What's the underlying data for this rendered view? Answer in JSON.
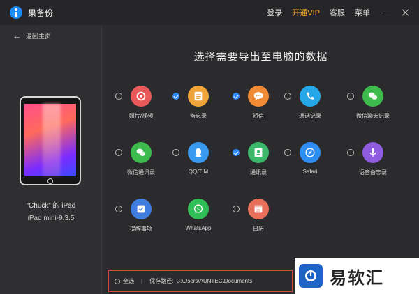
{
  "app": {
    "title": "果备份"
  },
  "topnav": {
    "login": "登录",
    "vip": "开通VIP",
    "service": "客服",
    "menu": "菜单"
  },
  "sidebar": {
    "back_label": "返回主页",
    "device_name": "“Chuck” 的 iPad",
    "device_model": "iPad mini-9.3.5"
  },
  "main": {
    "heading": "选择需要导出至电脑的数据",
    "items": [
      {
        "label": "照片/视频",
        "checked": false,
        "icon": "photos-icon",
        "color": "#e85a5a"
      },
      {
        "label": "备忘录",
        "checked": true,
        "icon": "notes-icon",
        "color": "#f0a53a"
      },
      {
        "label": "短信",
        "checked": true,
        "icon": "messages-icon",
        "color": "#f08a34"
      },
      {
        "label": "通话记录",
        "checked": false,
        "icon": "call-log-icon",
        "color": "#26a7e8"
      },
      {
        "label": "微信聊天记录",
        "checked": false,
        "icon": "wechat-chat-icon",
        "color": "#3dbb4c"
      },
      {
        "label": "微信通讯录",
        "checked": false,
        "icon": "wechat-contacts-icon",
        "color": "#3dbb4c"
      },
      {
        "label": "QQ/TIM",
        "checked": false,
        "icon": "qq-icon",
        "color": "#3a9af0"
      },
      {
        "label": "通讯录",
        "checked": true,
        "icon": "contacts-icon",
        "color": "#3cb86a"
      },
      {
        "label": "Safari",
        "checked": false,
        "icon": "safari-icon",
        "color": "#2f8cf0"
      },
      {
        "label": "语音备忘录",
        "checked": false,
        "icon": "voice-memo-icon",
        "color": "#8f5ce0"
      },
      {
        "label": "提醒事项",
        "checked": false,
        "icon": "reminders-icon",
        "color": "#3f7de0"
      },
      {
        "label": "WhatsApp",
        "checked": false,
        "icon": "whatsapp-icon",
        "color": "#2fbf56"
      },
      {
        "label": "日历",
        "checked": false,
        "icon": "calendar-icon",
        "color": "#e8705a"
      }
    ]
  },
  "bottom": {
    "select_all": "全选",
    "divider": "|",
    "save_path_label": "保存路径:",
    "save_path": "C:\\Users\\AUNTEC\\Documents"
  },
  "watermark": {
    "text": "易软汇"
  }
}
